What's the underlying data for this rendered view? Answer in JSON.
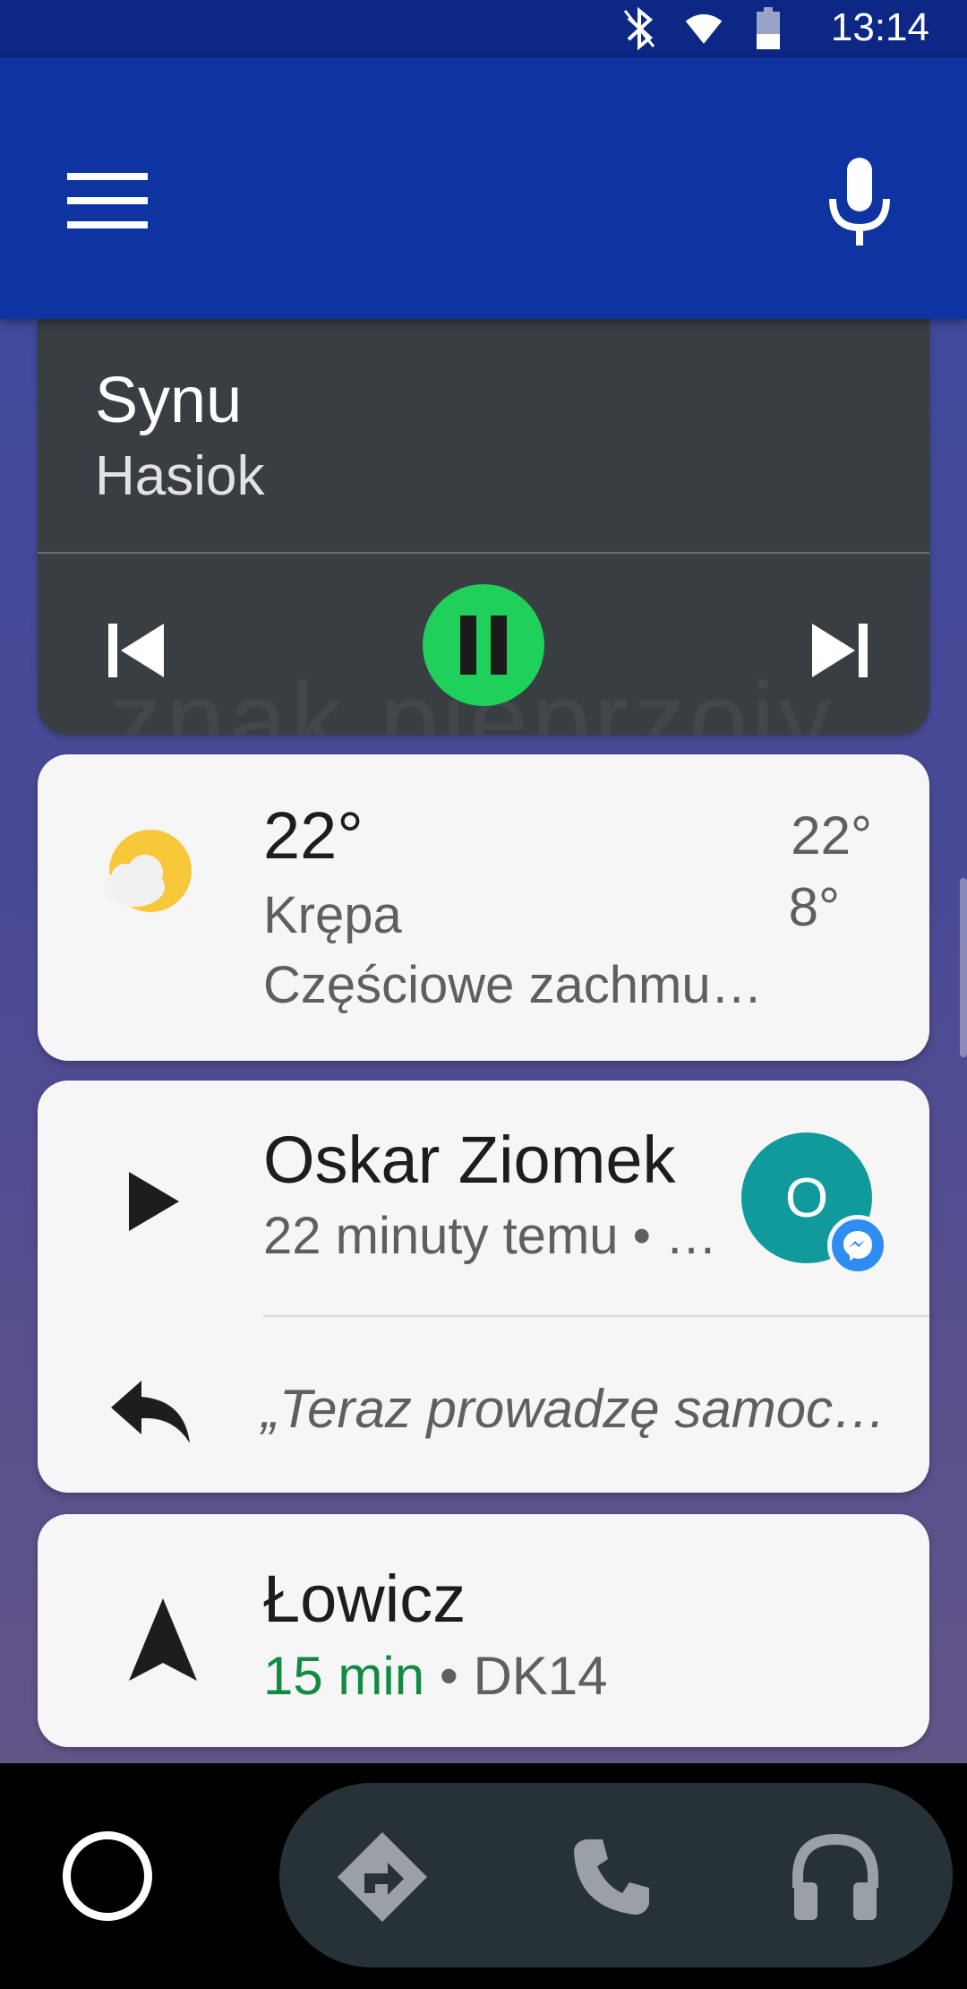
{
  "status_bar": {
    "time": "13:14",
    "icons": [
      "bluetooth-icon",
      "wifi-icon",
      "battery-icon"
    ]
  },
  "app_bar": {
    "menu_icon": "menu-icon",
    "mic_icon": "mic-icon"
  },
  "media": {
    "title": "Synu",
    "artist": "Hasiok",
    "background_text": "znak pieprzoiy",
    "state": "playing",
    "accent": "#1fd15a"
  },
  "weather": {
    "temperature": "22°",
    "city": "Krępa",
    "description": "Częściowe zachmu…",
    "high": "22°",
    "low": "8°"
  },
  "message": {
    "sender": "Oskar Ziomek",
    "meta": "22 minuty temu • …",
    "avatar_initial": "O",
    "avatar_color": "#109a9c",
    "badge_icon": "messenger-icon",
    "preview": "„Teraz prowadzę samoc…"
  },
  "navigation": {
    "destination": "Łowicz",
    "eta": "15 min",
    "separator": " • ",
    "road": "DK14",
    "eta_color": "#138a43"
  },
  "bottom_nav": {
    "items": [
      "home-icon",
      "directions-icon",
      "phone-icon",
      "headphones-icon"
    ]
  }
}
